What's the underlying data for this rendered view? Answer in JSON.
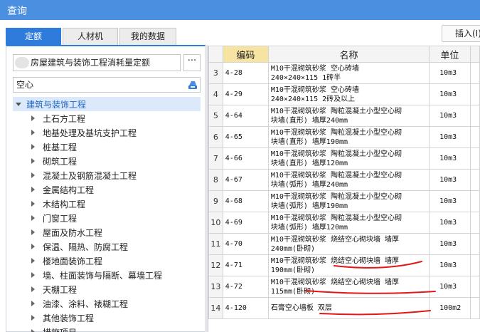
{
  "window": {
    "title": "查询"
  },
  "tabs": [
    "定额",
    "人材机",
    "我的数据"
  ],
  "insert_button": "插入(I)",
  "library": {
    "selected": "房屋建筑与装饰工程消耗量定额",
    "more": "···"
  },
  "search": {
    "value": "空心",
    "icon": "clear-icon"
  },
  "tree": {
    "root": "建筑与装饰工程",
    "items": [
      "土石方工程",
      "地基处理及基坑支护工程",
      "桩基工程",
      "砌筑工程",
      "混凝土及钢筋混凝土工程",
      "金属结构工程",
      "木结构工程",
      "门窗工程",
      "屋面及防水工程",
      "保温、隔热、防腐工程",
      "楼地面装饰工程",
      "墙、柱面装饰与隔断、幕墙工程",
      "天棚工程",
      "油漆、涂料、裱糊工程",
      "其他装饰工程",
      "措施项目"
    ]
  },
  "table": {
    "headers": [
      "",
      "编码",
      "名称",
      "单位",
      ""
    ],
    "rows": [
      {
        "n": "3",
        "code": "4-28",
        "name1": "M10干混砌筑砂浆 空心砖墙",
        "name2": "240×240×115 1砖半",
        "unit": "10m3"
      },
      {
        "n": "4",
        "code": "4-29",
        "name1": "M10干混砌筑砂浆 空心砖墙",
        "name2": "240×240×115 2砖及以上",
        "unit": "10m3"
      },
      {
        "n": "5",
        "code": "4-64",
        "name1": "M10干混砌筑砂浆 陶粒混凝土小型空心砌",
        "name2": "块墙(直形) 墙厚240mm",
        "unit": "10m3"
      },
      {
        "n": "6",
        "code": "4-65",
        "name1": "M10干混砌筑砂浆 陶粒混凝土小型空心砌",
        "name2": "块墙(直形) 墙厚190mm",
        "unit": "10m3"
      },
      {
        "n": "7",
        "code": "4-66",
        "name1": "M10干混砌筑砂浆 陶粒混凝土小型空心砌",
        "name2": "块墙(直形) 墙厚120mm",
        "unit": "10m3"
      },
      {
        "n": "8",
        "code": "4-67",
        "name1": "M10干混砌筑砂浆 陶粒混凝土小型空心砌",
        "name2": "块墙(弧形) 墙厚240mm",
        "unit": "10m3"
      },
      {
        "n": "9",
        "code": "4-68",
        "name1": "M10干混砌筑砂浆 陶粒混凝土小型空心砌",
        "name2": "块墙(弧形) 墙厚190mm",
        "unit": "10m3"
      },
      {
        "n": "10",
        "code": "4-69",
        "name1": "M10干混砌筑砂浆 陶粒混凝土小型空心砌",
        "name2": "块墙(弧形) 墙厚120mm",
        "unit": "10m3"
      },
      {
        "n": "11",
        "code": "4-70",
        "name1": "M10干混砌筑砂浆 烧结空心砌块墙 墙厚",
        "name2": "240mm(卧砌)",
        "unit": "10m3"
      },
      {
        "n": "12",
        "code": "4-71",
        "name1": "M10干混砌筑砂浆 烧结空心砌块墙 墙厚",
        "name2": "190mm(卧砌)",
        "unit": "10m3"
      },
      {
        "n": "13",
        "code": "4-72",
        "name1": "M10干混砌筑砂浆 烧结空心砌块墙 墙厚",
        "name2": "115mm(卧砌)",
        "unit": "10m3"
      },
      {
        "n": "14",
        "code": "4-120",
        "name1": "石膏空心墙板 双层",
        "name2": "",
        "unit": "100m2"
      }
    ]
  },
  "annotation_color": "#e01818",
  "accent_color": "#2f7bdc"
}
